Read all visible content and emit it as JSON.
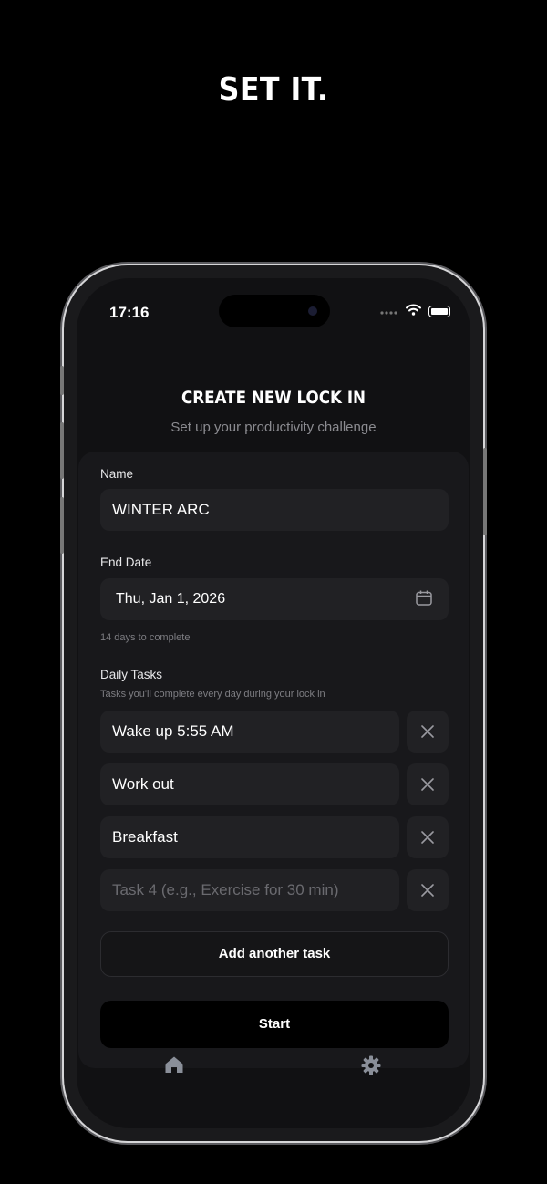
{
  "headline": "SET IT.",
  "status_bar": {
    "time": "17:16"
  },
  "screen": {
    "title": "CREATE NEW LOCK IN",
    "subtitle": "Set up your productivity challenge"
  },
  "form": {
    "name_label": "Name",
    "name_value": "WINTER ARC",
    "end_date_label": "End Date",
    "end_date_value": "Thu, Jan 1, 2026",
    "end_date_hint": "14 days to complete",
    "tasks_label": "Daily Tasks",
    "tasks_hint": "Tasks you'll complete every day during your lock in",
    "tasks": [
      "Wake up 5:55 AM",
      "Work out",
      "Breakfast"
    ],
    "task_placeholder": "Task 4 (e.g., Exercise for 30 min)",
    "add_task_label": "Add another task",
    "start_label": "Start"
  },
  "tab_bar": {
    "icons": [
      "home-icon",
      "gear-icon"
    ]
  },
  "colors": {
    "background": "#000000",
    "card": "#18181b",
    "field": "#212124",
    "muted": "#8b8b90"
  }
}
